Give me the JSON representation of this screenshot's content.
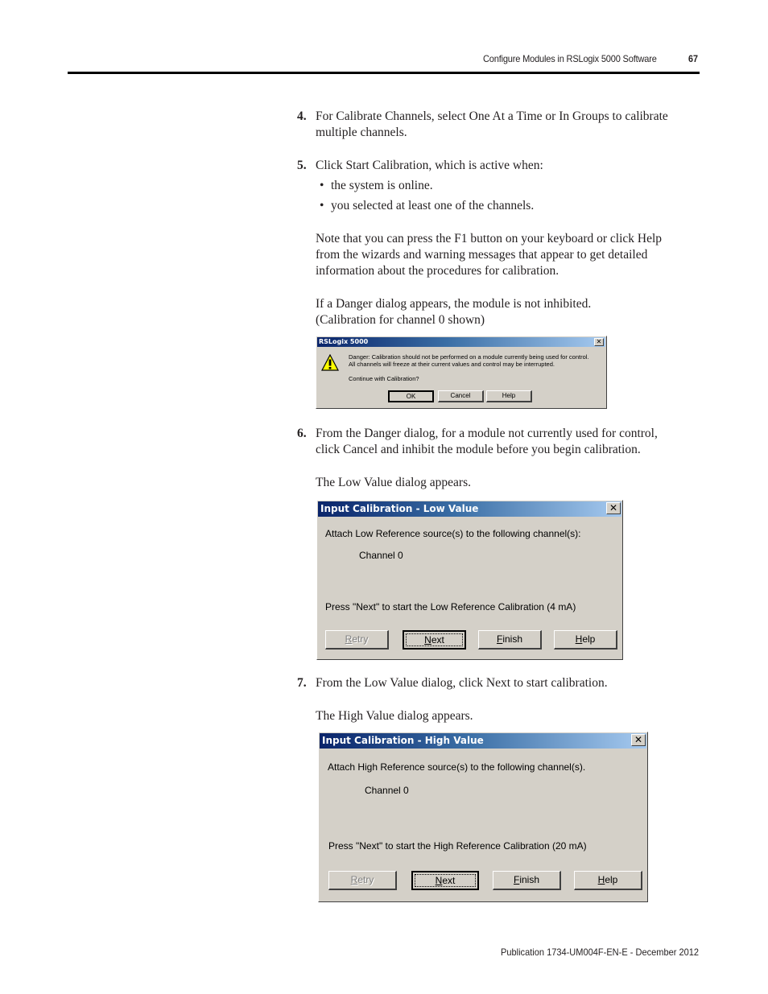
{
  "header": {
    "section_title": "Configure Modules in RSLogix 5000 Software",
    "page_number": "67"
  },
  "steps": {
    "step4": {
      "number": "4.",
      "lines": [
        "For Calibrate Channels, select One At a Time or In Groups to calibrate",
        "multiple channels."
      ]
    },
    "step5": {
      "number": "5.",
      "text": "Click Start Calibration, which is active when:",
      "bullets": [
        "the system is online.",
        "you selected at least one of the channels."
      ],
      "note_lines": [
        "Note that you can press the F1 button on your keyboard or click Help",
        "from the wizards and warning messages that appear to get detailed",
        "information about the procedures for calibration."
      ],
      "danger_lines": [
        "If a Danger dialog appears, the module is not inhibited.",
        "(Calibration for channel 0 shown)"
      ]
    },
    "step6": {
      "number": "6.",
      "lines": [
        "From the Danger dialog, for a module not currently used for control,",
        "click Cancel and inhibit the module before you begin calibration."
      ],
      "after": "The Low Value dialog appears."
    },
    "step7": {
      "number": "7.",
      "text": "From the Low Value dialog, click Next to start calibration.",
      "after": "The High Value dialog appears."
    }
  },
  "danger_dialog": {
    "title": "RSLogix 5000",
    "icon": "warning-icon",
    "message_lines": [
      "Danger: Calibration should not be performed on a module currently being used for control.",
      "All channels will freeze at their current values and control may be interrupted."
    ],
    "question": "Continue with Calibration?",
    "buttons": {
      "ok": "OK",
      "cancel": "Cancel",
      "help": "Help"
    },
    "close_glyph": "✕"
  },
  "low_dialog": {
    "title": "Input Calibration - Low Value",
    "instruction": "Attach Low Reference source(s) to the following channel(s):",
    "channel": "Channel 0",
    "prompt": "Press \"Next\" to start the Low Reference Calibration (4 mA)",
    "buttons": {
      "retry": {
        "first": "R",
        "rest": "etry",
        "enabled": false
      },
      "next": {
        "first": "N",
        "rest": "ext",
        "enabled": true,
        "default": true
      },
      "finish": {
        "first": "F",
        "rest": "inish",
        "enabled": true
      },
      "help": {
        "first": "H",
        "rest": "elp",
        "enabled": true
      }
    },
    "close_glyph": "✕"
  },
  "high_dialog": {
    "title": "Input Calibration - High Value",
    "instruction": "Attach High Reference source(s) to the following channel(s).",
    "channel": "Channel 0",
    "prompt": "Press \"Next\" to start the High Reference Calibration (20 mA)",
    "buttons": {
      "retry": {
        "first": "R",
        "rest": "etry",
        "enabled": false
      },
      "next": {
        "first": "N",
        "rest": "ext",
        "enabled": true,
        "default": true
      },
      "finish": {
        "first": "F",
        "rest": "inish",
        "enabled": true
      },
      "help": {
        "first": "H",
        "rest": "elp",
        "enabled": true
      }
    },
    "close_glyph": "✕"
  },
  "footer": {
    "publication": "Publication 1734-UM004F-EN-E - December 2012"
  }
}
